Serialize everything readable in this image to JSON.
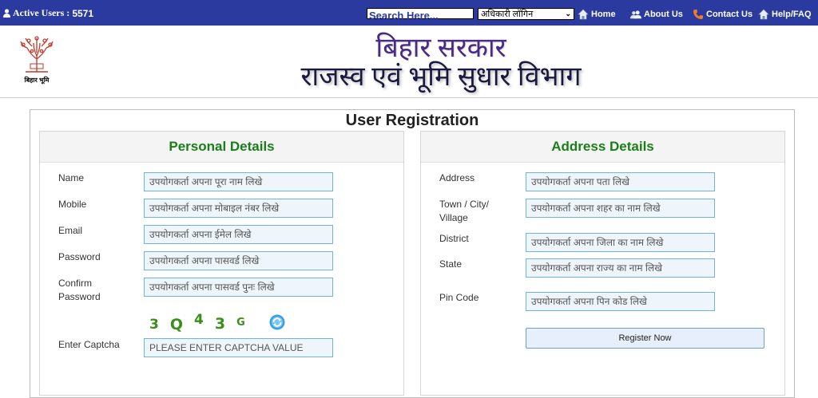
{
  "topbar": {
    "active_users_label": "Active Users :",
    "active_users_count": "5571",
    "search_placeholder": "Search Here...",
    "login_select_value": "अधिकारी लॉगिन",
    "nav": [
      {
        "label": "Home",
        "icon": "home-icon"
      },
      {
        "label": "About Us",
        "icon": "people-icon"
      },
      {
        "label": "Contact Us",
        "icon": "phone-icon"
      },
      {
        "label": "Help/FAQ",
        "icon": "home-icon"
      }
    ],
    "bg_color": "#2b3a9f"
  },
  "header": {
    "logo_caption": "बिहार भूमि",
    "title_line1": "बिहार सरकार",
    "title_line2": "राजस्व एवं भूमि सुधार विभाग"
  },
  "form": {
    "title": "User Registration",
    "personal": {
      "heading": "Personal Details",
      "fields": [
        {
          "label": "Name",
          "placeholder": "उपयोगकर्ता अपना पूरा नाम लिखे"
        },
        {
          "label": "Mobile",
          "placeholder": "उपयोगकर्ता अपना मोबाइल नंबर लिखे"
        },
        {
          "label": "Email",
          "placeholder": "उपयोगकर्ता अपना ईमेल लिखे"
        },
        {
          "label": "Password",
          "placeholder": "उपयोगकर्ता अपना पासवर्ड लिखे"
        },
        {
          "label_line1": "Confirm",
          "label_line2": "Password",
          "placeholder": "उपयोगकर्ता अपना पासवर्ड पुनः लिखे"
        }
      ],
      "captcha_chars": [
        "3",
        "Q",
        "4",
        "3",
        "G"
      ],
      "captcha_label": "Enter Captcha",
      "captcha_placeholder": "PLEASE ENTER CAPTCHA VALUE"
    },
    "address": {
      "heading": "Address Details",
      "fields": [
        {
          "label": "Address",
          "placeholder": "उपयोगकर्ता अपना पता लिखे"
        },
        {
          "label_line1": "Town / City/",
          "label_line2": "Village",
          "placeholder": "उपयोगकर्ता अपना शहर का नाम लिखे"
        },
        {
          "label": "District",
          "placeholder": "उपयोगकर्ता अपना जिला का नाम लिखे"
        },
        {
          "label": "State",
          "placeholder": "उपयोगकर्ता अपना राज्य का नाम लिखे"
        },
        {
          "label": "Pin Code",
          "placeholder": "उपयोगकर्ता अपना पिन कोड लिखे"
        }
      ],
      "submit_label": "Register Now"
    },
    "heading_color": "#1a7f1a"
  }
}
